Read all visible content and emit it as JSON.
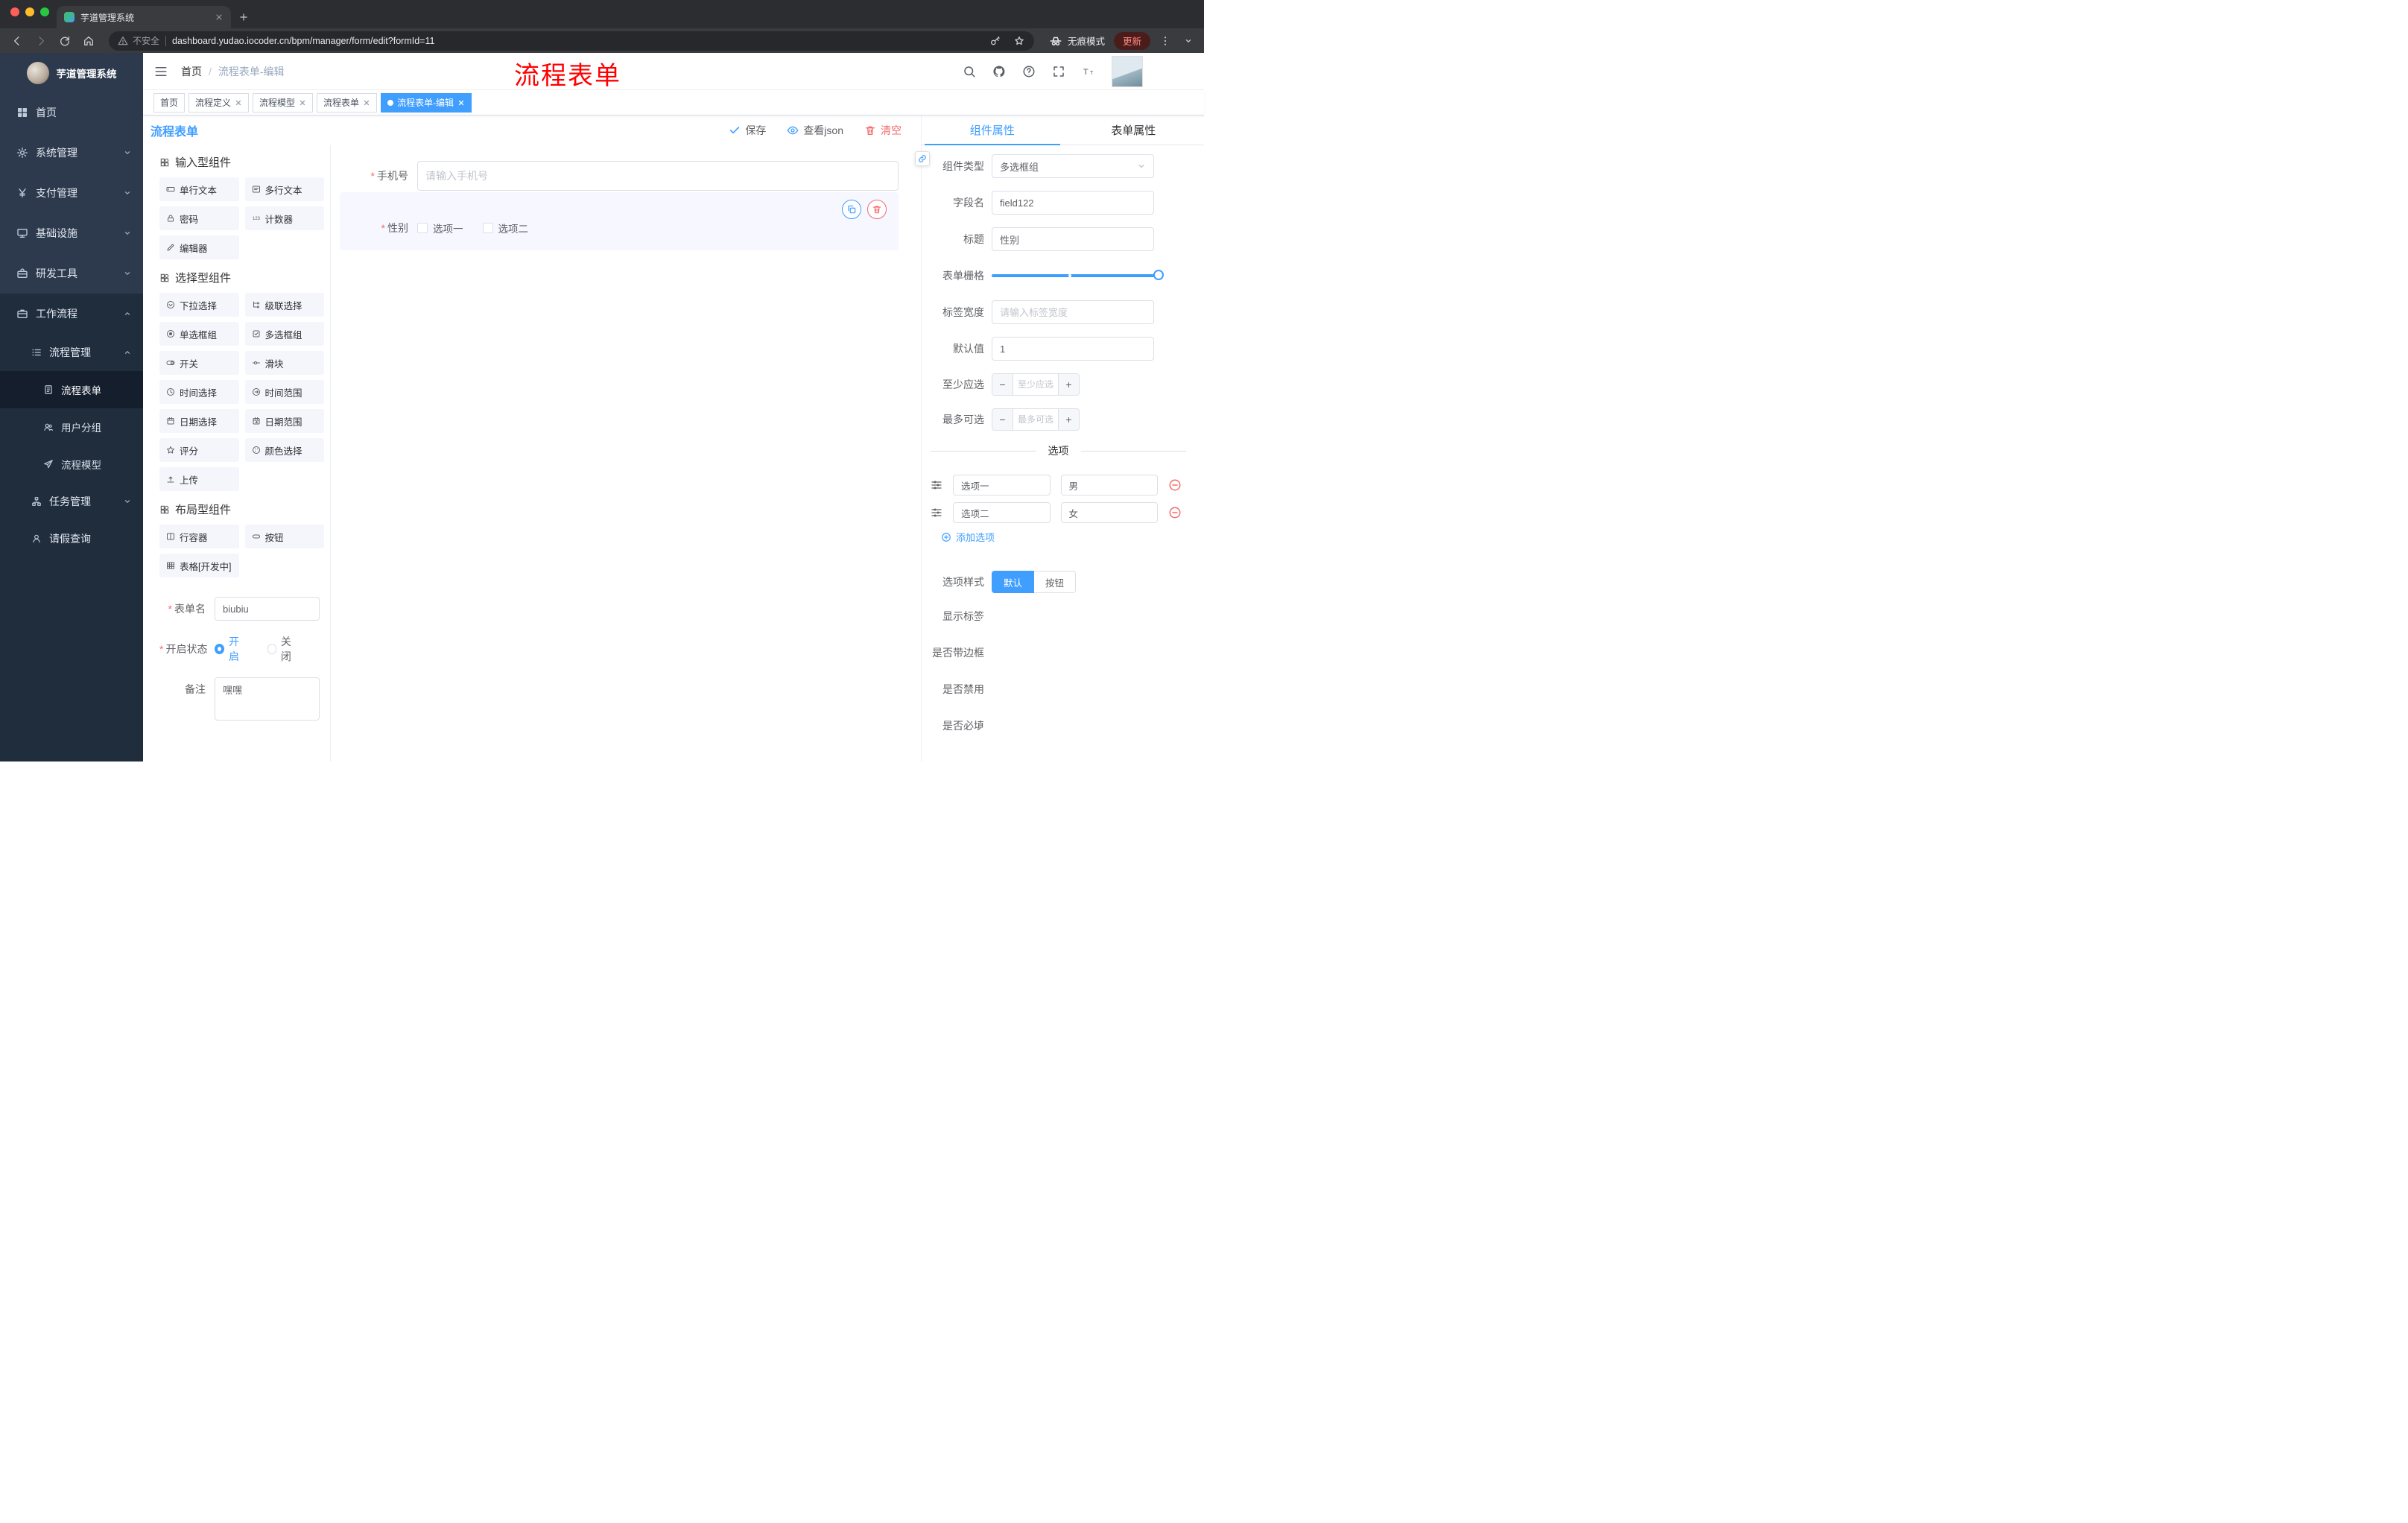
{
  "colors": {
    "accent": "#409EFF",
    "danger": "#F56C6C",
    "sidebar_bg": "#2D3A4D",
    "sidebar_submenu_bg": "#1F2D3D",
    "annotation": "#FF0000"
  },
  "browser": {
    "tab_title": "芋道管理系统",
    "security_label": "不安全",
    "url": "dashboard.yudao.iocoder.cn/bpm/manager/form/edit?formId=11",
    "incognito_label": "无痕模式",
    "update_label": "更新"
  },
  "sidebar": {
    "title": "芋道管理系统",
    "items": [
      {
        "label": "首页",
        "icon": "dashboard-icon",
        "level": 1
      },
      {
        "label": "系统管理",
        "icon": "gear-icon",
        "level": 1,
        "arrow": "down"
      },
      {
        "label": "支付管理",
        "icon": "yen-icon",
        "level": 1,
        "arrow": "down"
      },
      {
        "label": "基础设施",
        "icon": "infrastructure-icon",
        "level": 1,
        "arrow": "down"
      },
      {
        "label": "研发工具",
        "icon": "tools-icon",
        "level": 1,
        "arrow": "down"
      },
      {
        "label": "工作流程",
        "icon": "workflow-icon",
        "level": 1,
        "arrow": "up",
        "expanded": true
      },
      {
        "label": "流程管理",
        "icon": "process-list-icon",
        "level": 2,
        "arrow": "up",
        "expanded": true
      },
      {
        "label": "流程表单",
        "icon": "form-doc-icon",
        "level": 3,
        "active": true
      },
      {
        "label": "用户分组",
        "icon": "user-group-icon",
        "level": 3
      },
      {
        "label": "流程模型",
        "icon": "model-send-icon",
        "level": 3
      },
      {
        "label": "任务管理",
        "icon": "task-tree-icon",
        "level": 2,
        "arrow": "down"
      },
      {
        "label": "请假查询",
        "icon": "person-icon",
        "level": 2
      }
    ]
  },
  "navbar": {
    "breadcrumb": {
      "home": "首页",
      "separator": "/",
      "current": "流程表单-编辑"
    },
    "annotation": "流程表单"
  },
  "tags": [
    {
      "label": "首页",
      "closable": false,
      "active": false
    },
    {
      "label": "流程定义",
      "closable": true,
      "active": false
    },
    {
      "label": "流程模型",
      "closable": true,
      "active": false
    },
    {
      "label": "流程表单",
      "closable": true,
      "active": false
    },
    {
      "label": "流程表单-编辑",
      "closable": true,
      "active": true
    }
  ],
  "editor": {
    "title": "流程表单",
    "actions": {
      "save": "保存",
      "view_json": "查看json",
      "clear": "清空"
    }
  },
  "palette": {
    "groups": [
      {
        "title": "输入型组件",
        "items": [
          {
            "label": "单行文本",
            "icon": "input-icon"
          },
          {
            "label": "多行文本",
            "icon": "textarea-icon"
          },
          {
            "label": "密码",
            "icon": "password-icon"
          },
          {
            "label": "计数器",
            "icon": "counter-icon"
          },
          {
            "label": "编辑器",
            "icon": "editor-icon"
          }
        ]
      },
      {
        "title": "选择型组件",
        "items": [
          {
            "label": "下拉选择",
            "icon": "select-icon"
          },
          {
            "label": "级联选择",
            "icon": "cascader-icon"
          },
          {
            "label": "单选框组",
            "icon": "radio-icon"
          },
          {
            "label": "多选框组",
            "icon": "checkbox-icon"
          },
          {
            "label": "开关",
            "icon": "switch-icon"
          },
          {
            "label": "滑块",
            "icon": "slider-icon"
          },
          {
            "label": "时间选择",
            "icon": "time-icon"
          },
          {
            "label": "时间范围",
            "icon": "time-range-icon"
          },
          {
            "label": "日期选择",
            "icon": "date-icon"
          },
          {
            "label": "日期范围",
            "icon": "date-range-icon"
          },
          {
            "label": "评分",
            "icon": "rate-star-icon"
          },
          {
            "label": "颜色选择",
            "icon": "color-icon"
          },
          {
            "label": "上传",
            "icon": "upload-icon"
          }
        ]
      },
      {
        "title": "布局型组件",
        "items": [
          {
            "label": "行容器",
            "icon": "row-container-icon"
          },
          {
            "label": "按钮",
            "icon": "button-icon"
          },
          {
            "label": "表格[开发中]",
            "icon": "table-icon"
          }
        ]
      }
    ]
  },
  "form_meta": {
    "name_label": "表单名",
    "name_value": "biubiu",
    "status_label": "开启状态",
    "status_on": "开启",
    "status_off": "关闭",
    "status_value": "开启",
    "remark_label": "备注",
    "remark_value": "嘿嘿"
  },
  "canvas": {
    "phone": {
      "label": "手机号",
      "placeholder": "请输入手机号",
      "required": true
    },
    "gender": {
      "label": "性别",
      "required": true,
      "options": [
        "选项一",
        "选项二"
      ],
      "selected": true
    }
  },
  "props": {
    "tabs": {
      "component": "组件属性",
      "form": "表单属性"
    },
    "component_type": {
      "label": "组件类型",
      "value": "多选框组"
    },
    "field_name": {
      "label": "字段名",
      "value": "field122"
    },
    "title": {
      "label": "标题",
      "value": "性别"
    },
    "grid": {
      "label": "表单栅格"
    },
    "label_width": {
      "label": "标签宽度",
      "placeholder": "请输入标签宽度"
    },
    "default": {
      "label": "默认值",
      "value": "1"
    },
    "min": {
      "label": "至少应选",
      "placeholder": "至少应选"
    },
    "max": {
      "label": "最多可选",
      "placeholder": "最多可选"
    },
    "options": {
      "divider": "选项",
      "rows": [
        {
          "label": "选项一",
          "value": "男"
        },
        {
          "label": "选项二",
          "value": "女"
        }
      ],
      "add": "添加选项"
    },
    "option_style": {
      "label": "选项样式",
      "default_option": "默认",
      "button_option": "按钮",
      "active": "默认"
    },
    "toggles": [
      {
        "label": "显示标签",
        "on": true
      },
      {
        "label": "是否带边框",
        "on": false
      },
      {
        "label": "是否禁用",
        "on": false
      },
      {
        "label": "是否必填",
        "on": true
      }
    ]
  }
}
